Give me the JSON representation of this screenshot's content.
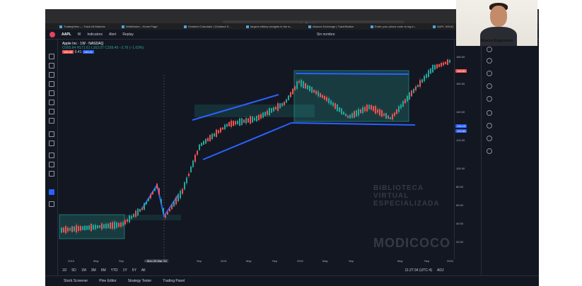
{
  "browser": {
    "url": "tradingview.com",
    "bookmarks": [
      "TradingView — Track All Markets",
      "WebBroker - Home Page",
      "Dividend Calculator | Dividend S...",
      "largest military budgets in the w...",
      "Abacus Exchange | TradeStation",
      "Enter your phone code to log in...",
      "AAPL 169.81"
    ]
  },
  "toolbar": {
    "symbol": "AAPL",
    "interval": "W",
    "indicators": "Indicators",
    "alert": "Alert",
    "replay": "Replay",
    "layout_name": "Sin nombre"
  },
  "legend": {
    "title": "Apple Inc · 1W · NASDAQ",
    "ohlc": "O165.64 H171.61 L162.07 C169.46 −2.76 (−1.63%)",
    "bid": "169.40",
    "spread": "0.41",
    "ask": "169.81"
  },
  "price_axis": [
    "180.00",
    "160.00",
    "140.00",
    "120.00",
    "100.00",
    "80.00",
    "60.00",
    "40.00",
    "20.00"
  ],
  "price_tags": {
    "current": "169.81",
    "mid": "134.13",
    "mid2": "129.84"
  },
  "time_axis": [
    "2019",
    "May",
    "Sep",
    "2020",
    "Sep",
    "2021",
    "May",
    "Sep",
    "2022",
    "May",
    "Sep",
    "May",
    "Sep",
    "2024"
  ],
  "crosshair_date": "Mon 09 Mar '20",
  "timeframes": [
    "1D",
    "5D",
    "1M",
    "3M",
    "6M",
    "YTD",
    "1Y",
    "5Y",
    "All"
  ],
  "clock": "11:27:34 (UTC-4)",
  "adj": "ADJ",
  "bottom_tabs": [
    "Stock Screener",
    "Pine Editor",
    "Strategy Tester",
    "Trading Panel"
  ],
  "drawing_style": {
    "thickness": "2px"
  },
  "webcam_caption": "Abacus Experience",
  "watermark": [
    "BIBLIOTECA VIRTUAL",
    "ESPECIALIZADA",
    "MODICOCO"
  ],
  "colors": {
    "bg": "#131722",
    "up": "#26a69a",
    "down": "#ef5350",
    "line": "#2962ff"
  }
}
